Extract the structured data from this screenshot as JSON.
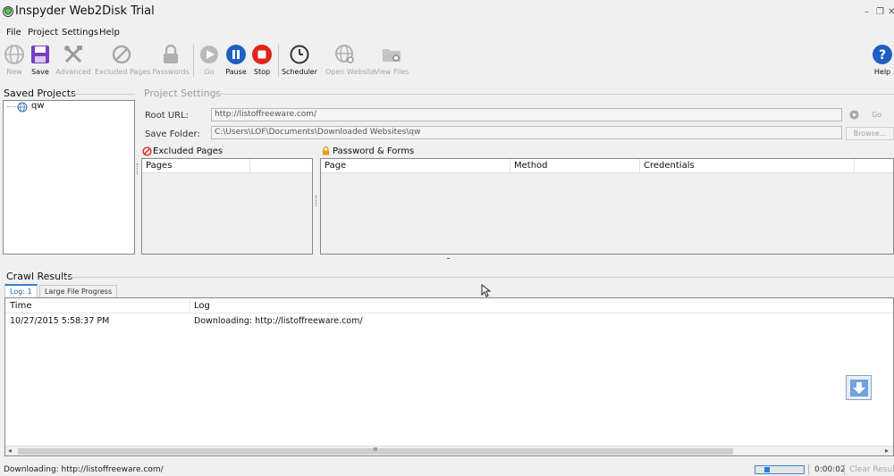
{
  "window": {
    "title": "Inspyder Web2Disk Trial",
    "controls": {
      "minimize": "–",
      "restore": "❐",
      "close": "✕"
    }
  },
  "menu": [
    "File",
    "Project",
    "Settings",
    "Help"
  ],
  "toolbar": {
    "new": "New",
    "save": "Save",
    "advanced": "Advanced",
    "excluded_pages": "Excluded Pages",
    "passwords": "Passwords",
    "go": "Go",
    "pause": "Pause",
    "stop": "Stop",
    "scheduler": "Scheduler",
    "open_website": "Open Website",
    "view_files": "View Files",
    "help": "Help"
  },
  "saved_projects": {
    "title": "Saved Projects",
    "items": [
      {
        "label": "qw",
        "icon": "globe-icon"
      }
    ]
  },
  "project_settings": {
    "title": "Project Settings",
    "root_url_label": "Root URL:",
    "root_url_value": "http://listoffreeware.com/",
    "go_label": "Go",
    "save_folder_label": "Save Folder:",
    "save_folder_value": "C:\\Users\\LOF\\Documents\\Downloaded Websites\\qw",
    "browse_label": "Browse..."
  },
  "excluded_pages": {
    "title": "Excluded Pages",
    "columns": [
      "Pages"
    ]
  },
  "password_forms": {
    "title": "Password & Forms",
    "columns": [
      "Page",
      "Method",
      "Credentials"
    ]
  },
  "crawl_results": {
    "title": "Crawl Results",
    "tabs": [
      "Log: 1",
      "Large File Progress"
    ],
    "active_tab": 0,
    "columns": [
      "Time",
      "Log"
    ],
    "rows": [
      {
        "time": "10/27/2015 5:58:37 PM",
        "log": "Downloading: http://listoffreeware.com/"
      }
    ]
  },
  "status": {
    "text": "Downloading: http://listoffreeware.com/",
    "progress": 0.2,
    "elapsed": "0:00:02",
    "clear_results": "Clear Results"
  },
  "colors": {
    "pause": "#1f5fc4",
    "stop": "#e0241b",
    "help": "#1f5fc4",
    "save": "#7a3ec2",
    "excluded": "#e0241b",
    "lock": "#e8a019"
  }
}
